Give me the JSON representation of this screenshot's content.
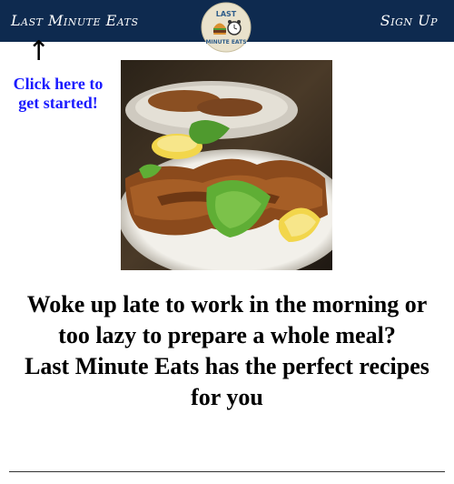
{
  "nav": {
    "brand_label": "Last Minute Eats",
    "signup_label": "Sign Up",
    "background_color": "#0e2a4f",
    "logo": {
      "text_top": "LAST",
      "text_bottom": "MINUTE EATS",
      "icons": [
        "burger-icon",
        "alarm-clock-icon"
      ]
    }
  },
  "hero": {
    "arrow_glyph": "↑",
    "cta_text": "Click here to get started!",
    "cta_color": "#1a1aff",
    "image_name": "schnitzel-plate-photo"
  },
  "headline": {
    "line1": "Woke up late to work in the morning or too lazy to prepare a whole meal?",
    "line2": "Last Minute Eats has the perfect recipes for you"
  }
}
